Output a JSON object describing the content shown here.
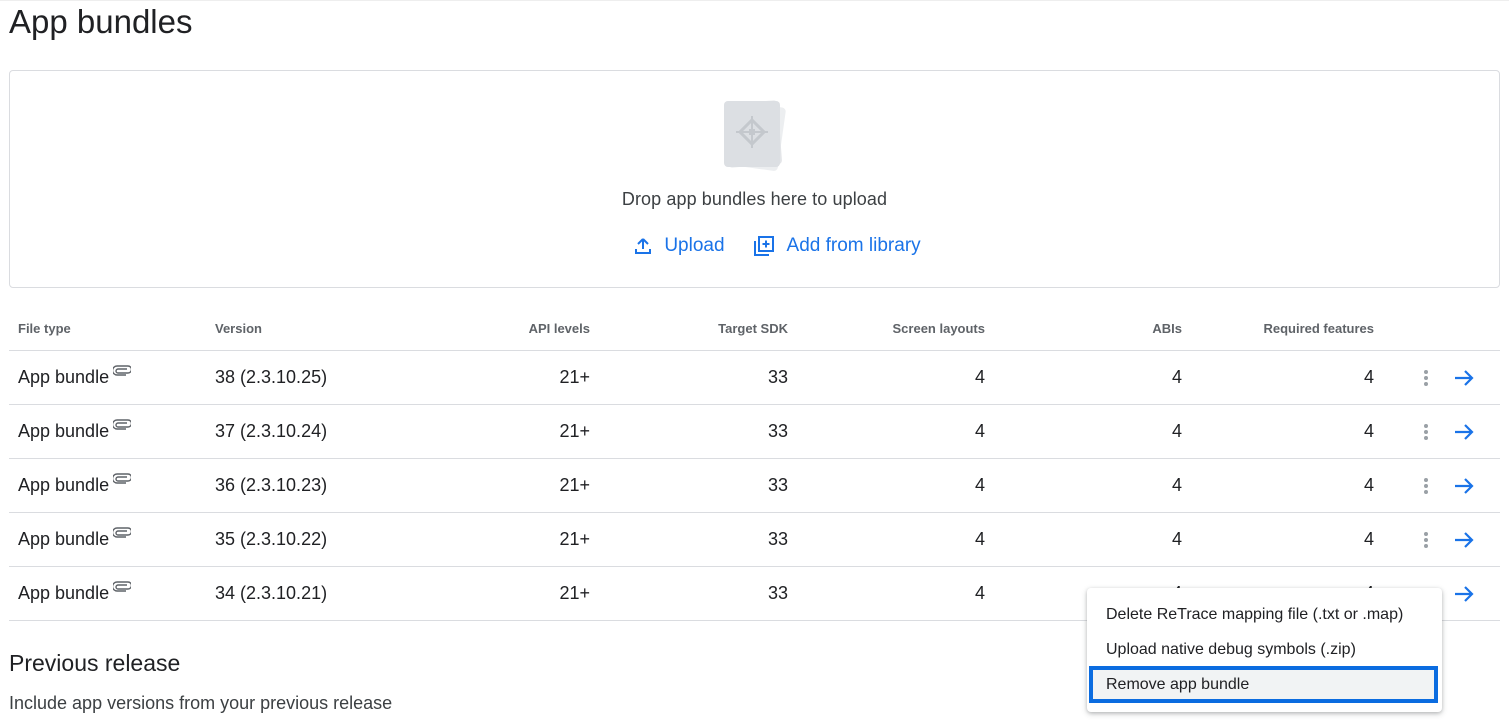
{
  "page": {
    "title": "App bundles"
  },
  "dropzone": {
    "text": "Drop app bundles here to upload",
    "upload_label": "Upload",
    "add_library_label": "Add from library"
  },
  "table": {
    "headers": {
      "file_type": "File type",
      "version": "Version",
      "api_levels": "API levels",
      "target_sdk": "Target SDK",
      "screen_layouts": "Screen layouts",
      "abis": "ABIs",
      "required_features": "Required features"
    },
    "rows": [
      {
        "file_type": "App bundle",
        "version": "38 (2.3.10.25)",
        "api_levels": "21+",
        "target_sdk": "33",
        "screen_layouts": "4",
        "abis": "4",
        "required_features": "4"
      },
      {
        "file_type": "App bundle",
        "version": "37 (2.3.10.24)",
        "api_levels": "21+",
        "target_sdk": "33",
        "screen_layouts": "4",
        "abis": "4",
        "required_features": "4"
      },
      {
        "file_type": "App bundle",
        "version": "36 (2.3.10.23)",
        "api_levels": "21+",
        "target_sdk": "33",
        "screen_layouts": "4",
        "abis": "4",
        "required_features": "4"
      },
      {
        "file_type": "App bundle",
        "version": "35 (2.3.10.22)",
        "api_levels": "21+",
        "target_sdk": "33",
        "screen_layouts": "4",
        "abis": "4",
        "required_features": "4"
      },
      {
        "file_type": "App bundle",
        "version": "34 (2.3.10.21)",
        "api_levels": "21+",
        "target_sdk": "33",
        "screen_layouts": "4",
        "abis": "4",
        "required_features": "4"
      }
    ]
  },
  "previous_release": {
    "title": "Previous release",
    "subtitle": "Include app versions from your previous release"
  },
  "context_menu": {
    "items": [
      "Delete ReTrace mapping file (.txt or .map)",
      "Upload native debug symbols (.zip)",
      "Remove app bundle"
    ],
    "highlighted_index": 2
  },
  "colors": {
    "accent": "#1a73e8",
    "highlight_border": "#0b6ce0",
    "divider": "#dadce0",
    "text_primary": "#202124",
    "text_secondary": "#5f6368"
  },
  "icons": {
    "upload": "upload-icon",
    "add_library": "add-to-library-icon",
    "attachment": "attachment-icon",
    "more": "more-vert-icon",
    "open": "arrow-forward-icon"
  }
}
